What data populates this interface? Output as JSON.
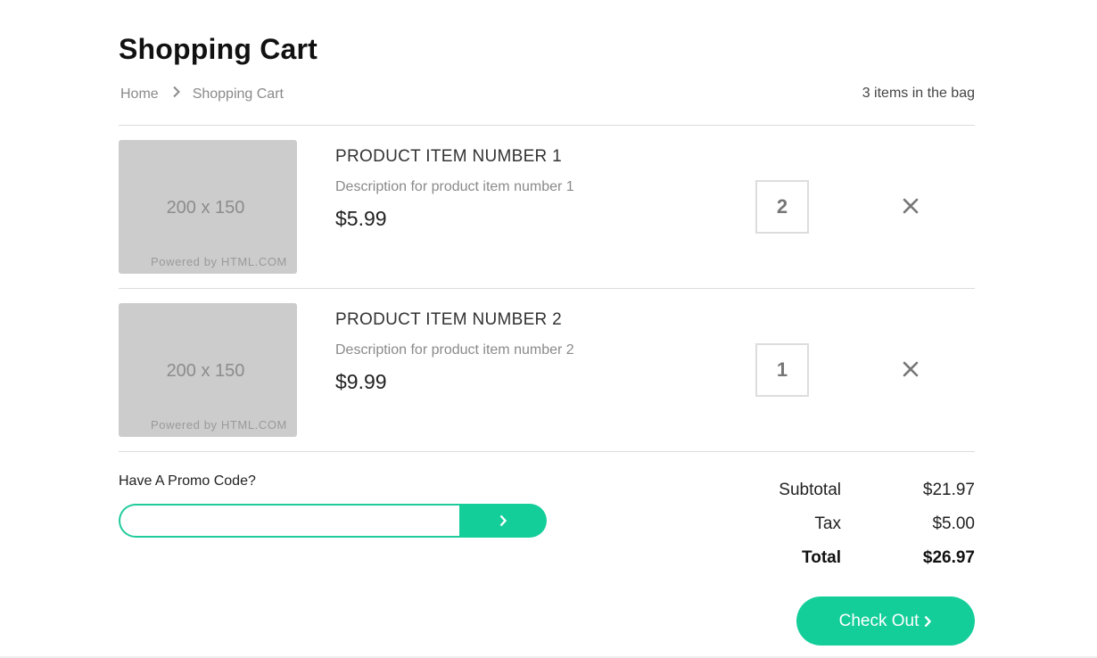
{
  "page": {
    "title": "Shopping Cart",
    "breadcrumb": [
      "Home",
      "Shopping Cart"
    ],
    "bag_count": "3 items in the bag"
  },
  "items": [
    {
      "thumbnail_size": "200 x 150",
      "thumbnail_credit": "Powered by HTML.COM",
      "name": "PRODUCT ITEM NUMBER 1",
      "description": "Description for product item number 1",
      "price": "$5.99",
      "quantity": "2",
      "remove_icon": "close-icon"
    },
    {
      "thumbnail_size": "200 x 150",
      "thumbnail_credit": "Powered by HTML.COM",
      "name": "PRODUCT ITEM NUMBER 2",
      "description": "Description for product item number 2",
      "price": "$9.99",
      "quantity": "1",
      "remove_icon": "close-icon"
    }
  ],
  "promo": {
    "label": "Have A Promo Code?",
    "value": "",
    "placeholder": "",
    "submit_icon": "chevron-right-icon"
  },
  "summary": {
    "subtotal_label": "Subtotal",
    "subtotal_value": "$21.97",
    "tax_label": "Tax",
    "tax_value": "$5.00",
    "total_label": "Total",
    "total_value": "$26.97"
  },
  "checkout": {
    "label": "Check Out",
    "icon": "chevron-right-icon"
  },
  "colors": {
    "accent": "#14ce9a",
    "thumbnail_bg": "#cccccc",
    "divider": "#dcdcdc"
  }
}
